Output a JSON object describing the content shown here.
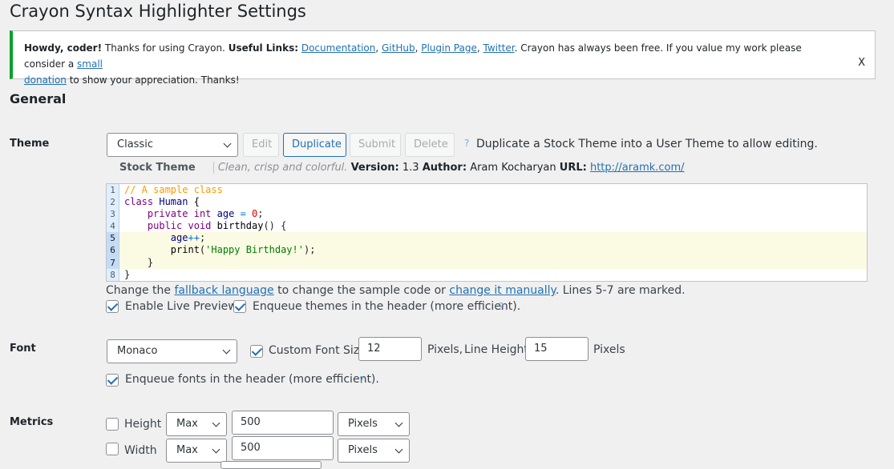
{
  "page": {
    "title": "Crayon Syntax Highlighter Settings"
  },
  "notice": {
    "greeting": "Howdy, coder!",
    "thanks": " Thanks for using Crayon. ",
    "links_label": "Useful Links:",
    "link_documentation": "Documentation",
    "link_github": "GitHub",
    "link_plugin_page": "Plugin Page",
    "link_twitter": "Twitter",
    "free_text": ". Crayon has always been free. If you value my work please consider a ",
    "link_small": "small",
    "link_donation": "donation",
    "appreciation": " to show your appreciation. Thanks!",
    "dismiss": "X"
  },
  "section_general": "General",
  "theme": {
    "label": "Theme",
    "selected": "Classic",
    "edit": "Edit",
    "duplicate": "Duplicate",
    "submit": "Submit",
    "delete": "Delete",
    "help": "?",
    "hint": "Duplicate a Stock Theme into a User Theme to allow editing.",
    "stock_label": "Stock Theme",
    "description": "Clean, crisp and colorful.",
    "version_label": "Version:",
    "version": "1.3",
    "author_label": "Author:",
    "author": "Aram Kocharyan",
    "url_label": "URL:",
    "url": "http://aramk.com/"
  },
  "code_sample": {
    "line_numbers": [
      "1",
      "2",
      "3",
      "4",
      "5",
      "6",
      "7",
      "8"
    ],
    "marked_lines": [
      5,
      6,
      7
    ]
  },
  "preview_note": {
    "prefix": "Change the ",
    "link_fallback": "fallback language",
    "middle": " to change the sample code or ",
    "link_manual": "change it manually",
    "suffix": ". Lines 5-7 are marked."
  },
  "options": {
    "live_preview": "Enable Live Preview",
    "enqueue_themes": "Enqueue themes in the header (more efficient).",
    "help": "?"
  },
  "font": {
    "label": "Font",
    "selected": "Monaco",
    "custom_size_label": "Custom Font Size",
    "size": "12",
    "pixels1": "Pixels,",
    "line_height_label": "Line Height",
    "line_height": "15",
    "pixels2": "Pixels",
    "enqueue_fonts": "Enqueue fonts in the header (more efficient).",
    "help": "?"
  },
  "metrics": {
    "label": "Metrics",
    "height_label": "Height",
    "height_mode": "Max",
    "height_value": "500",
    "height_unit": "Pixels",
    "width_label": "Width",
    "width_mode": "Max",
    "width_value": "500",
    "width_unit": "Pixels"
  }
}
